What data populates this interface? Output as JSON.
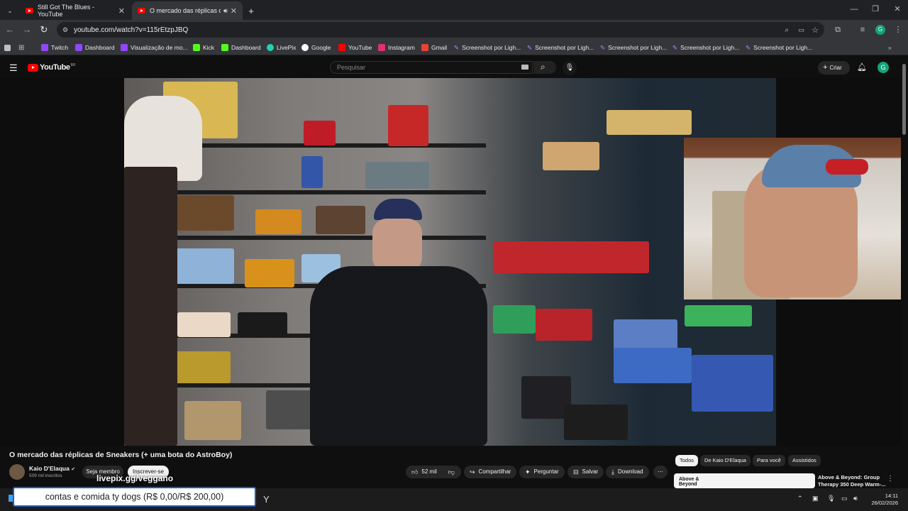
{
  "browser": {
    "tabs": [
      {
        "title": "Still Got The Blues - YouTube",
        "active": false
      },
      {
        "title": "O mercado das réplicas de",
        "active": true
      }
    ],
    "new_tab_icon": "plus-icon",
    "address": "youtube.com/watch?v=115rEtzpJBQ",
    "bookmarks": [
      {
        "label": "Twitch",
        "color": "#9146ff"
      },
      {
        "label": "Dashboard",
        "color": "#9146ff"
      },
      {
        "label": "Visualização de mo...",
        "color": "#9146ff"
      },
      {
        "label": "Kick",
        "color": "#53fc18"
      },
      {
        "label": "Dashboard",
        "color": "#53fc18"
      },
      {
        "label": "LivePix",
        "color": "#1fd3b1"
      },
      {
        "label": "Google",
        "color": "#ffffff"
      },
      {
        "label": "YouTube",
        "color": "#ff0000"
      },
      {
        "label": "Instagram",
        "color": "#e1306c"
      },
      {
        "label": "Gmail",
        "color": "#ea4335"
      },
      {
        "label": "Screenshot por Ligh...",
        "color": "#b388ff"
      },
      {
        "label": "Screenshot por Ligh...",
        "color": "#b388ff"
      },
      {
        "label": "Screenshot por Ligh...",
        "color": "#b388ff"
      },
      {
        "label": "Screenshot por Ligh...",
        "color": "#b388ff"
      },
      {
        "label": "Screenshot por Ligh...",
        "color": "#b388ff"
      }
    ]
  },
  "youtube": {
    "logo_text": "YouTube",
    "logo_sup": "BR",
    "search_placeholder": "Pesquisar",
    "create_label": "Criar",
    "avatar_letter": "G",
    "video_title": "O mercado das réplicas de Sneakers (+ uma bota do AstroBoy)",
    "channel_name": "Kaio D'Elaqua",
    "subscribers": "509 mil inscritos",
    "member_label": "Seja membro",
    "subscribe_label": "Inscrever-se",
    "likes": "52 mil",
    "share_label": "Compartilhar",
    "ask_label": "Perguntar",
    "save_label": "Salvar",
    "download_label": "Download",
    "chips": [
      "Todos",
      "De Kaio D'Elaqua",
      "Para você",
      "Assistidos"
    ],
    "recommended": {
      "title": "Above & Beyond: Group Therapy 350 Deep Warm-...",
      "thumb_text": "Above & Beyond"
    }
  },
  "stream_overlay": {
    "url_text": "livepix.gg/veggano",
    "donation_text": "contas e comida ty dogs (R$ 0,00/R$ 200,00)"
  },
  "taskbar": {
    "time": "14:11",
    "date": "26/02/2026"
  },
  "colors": {
    "youtube_red": "#ff0000",
    "profile_green": "#16a37c",
    "donation_border": "#1d5fc2"
  }
}
